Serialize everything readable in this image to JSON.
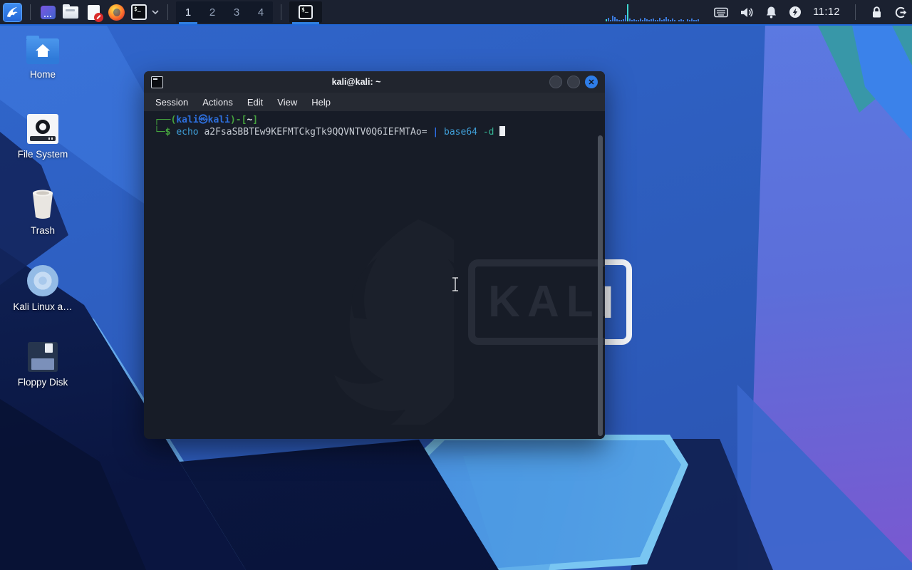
{
  "panel": {
    "workspaces": [
      "1",
      "2",
      "3",
      "4"
    ],
    "active_workspace": "1",
    "launcher_icons": [
      "kali-menu",
      "app-window",
      "file-manager",
      "text-editor",
      "firefox",
      "terminal",
      "chevron-down"
    ],
    "tray_icons": [
      "network-graph",
      "keyboard",
      "volume",
      "notifications-bell",
      "power-manager",
      "lock",
      "logout"
    ],
    "clock": "11:12",
    "graph": {
      "bars": [
        3,
        5,
        2,
        8,
        6,
        3,
        2,
        2,
        3,
        9,
        24,
        4,
        2,
        3,
        2,
        2,
        4,
        2,
        5,
        3,
        2,
        3,
        4,
        2,
        2,
        5,
        2,
        3,
        6,
        3,
        2,
        4,
        2,
        0,
        2,
        3,
        2,
        0,
        3,
        2,
        4,
        2,
        2,
        3
      ],
      "cyan": [
        0,
        10
      ]
    }
  },
  "desktop": {
    "icons": [
      {
        "label": "Home",
        "icon": "home-folder"
      },
      {
        "label": "File System",
        "icon": "hard-drive"
      },
      {
        "label": "Trash",
        "icon": "trash-can"
      },
      {
        "label": "Kali Linux a…",
        "icon": "optical-disc"
      },
      {
        "label": "Floppy Disk",
        "icon": "floppy-disk"
      }
    ]
  },
  "wallpaper": {
    "logo_text": "KALI"
  },
  "terminal": {
    "title": "kali@kali: ~",
    "menu": [
      "Session",
      "Actions",
      "Edit",
      "View",
      "Help"
    ],
    "watermark_text": "KALI",
    "prompt": {
      "l1_open": "┌──(",
      "user": "kali",
      "at": "㉿",
      "host": "kali",
      "l1_mid": ")-[",
      "path": "~",
      "l1_close": "]",
      "l2_open": "└─",
      "dollar": "$"
    },
    "command": {
      "cmd": "echo",
      "arg": "a2FsaSBBTEw9KEFMTCkgTk9QQVNTV0Q6IEFMTAo=",
      "pipe": "|",
      "cmd2": "base64",
      "flag": "-d"
    },
    "window_buttons": [
      "minimize",
      "maximize",
      "close"
    ],
    "close_glyph": "✕"
  },
  "colors": {
    "accent": "#2e7de8",
    "panel_bg": "#1b2130",
    "terminal_bg": "#171c27",
    "prompt_green": "#45a33e",
    "prompt_blue": "#2d6fdd",
    "command_blue": "#3f9fd8",
    "flag_teal": "#36b596",
    "graph_blue": "#3c7ce0",
    "graph_cyan": "#3fd9d2"
  }
}
